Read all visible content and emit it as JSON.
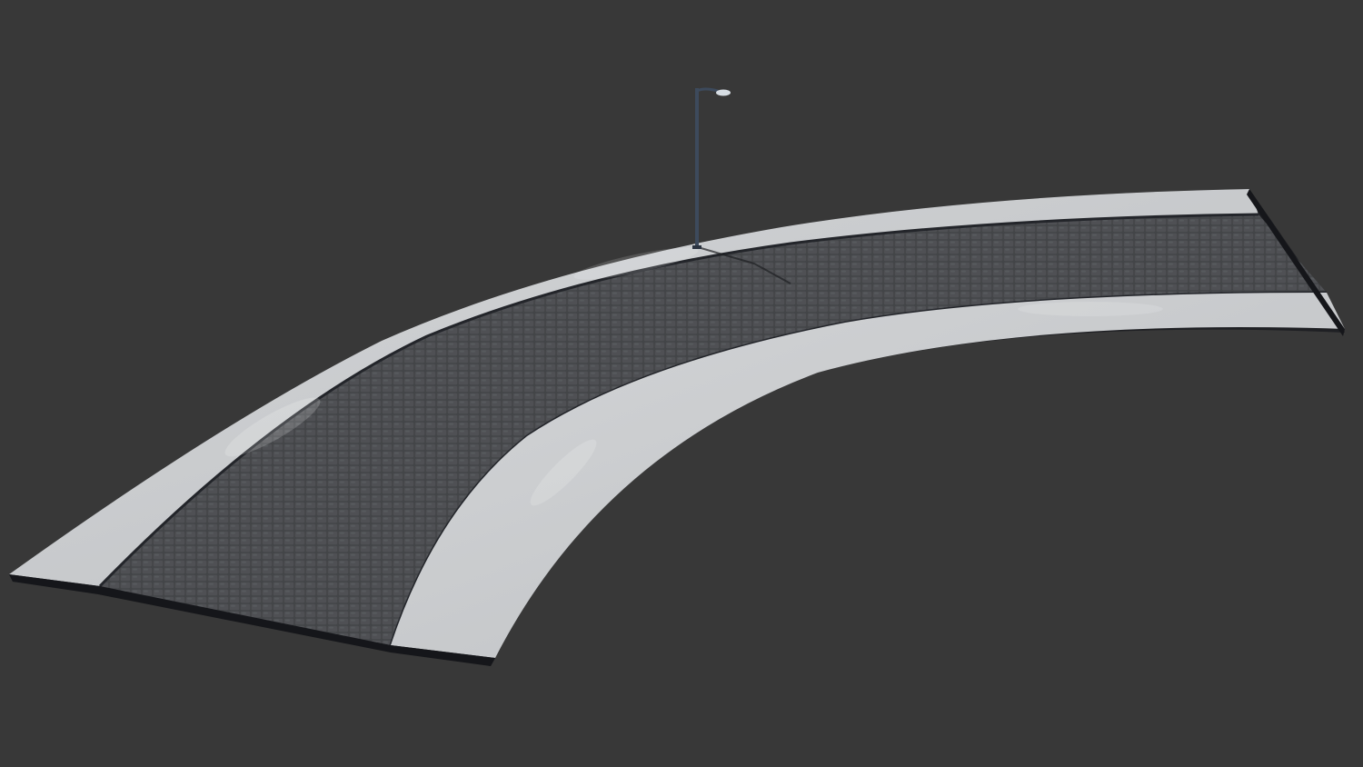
{
  "scene": {
    "background_color": "#383838",
    "sidewalk_color": "#c9cbcd",
    "sidewalk_edge_color": "#1f2024",
    "cobblestone_color": "#4d4f52",
    "cobblestone_seam_color": "#2c2d30",
    "lamp_color": "#3d4a5c",
    "lamp_head_color": "#d7dde3",
    "icons": [
      "street-lamp-icon"
    ]
  }
}
